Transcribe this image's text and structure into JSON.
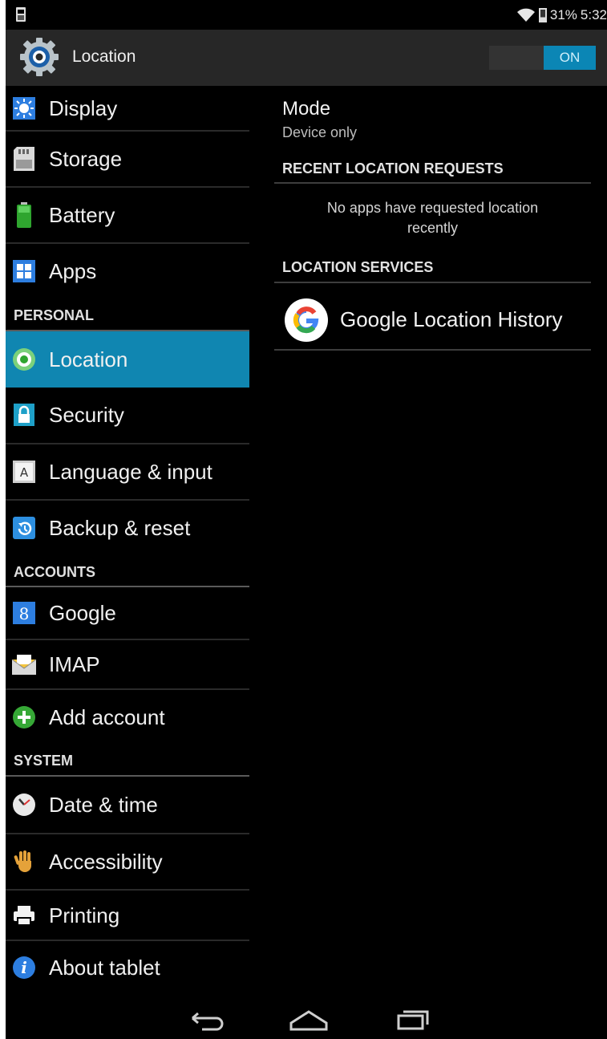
{
  "status_bar": {
    "battery": "31%",
    "time": "5:32"
  },
  "action_bar": {
    "title": "Location",
    "switch_label": "ON"
  },
  "left_list": [
    {
      "type": "item",
      "label": "Display",
      "icon": "display-icon"
    },
    {
      "type": "item",
      "label": "Storage",
      "icon": "storage-icon"
    },
    {
      "type": "item",
      "label": "Battery",
      "icon": "battery-icon"
    },
    {
      "type": "item",
      "label": "Apps",
      "icon": "apps-icon"
    },
    {
      "type": "header",
      "label": "PERSONAL"
    },
    {
      "type": "item",
      "label": "Location",
      "icon": "location-icon",
      "selected": true
    },
    {
      "type": "item",
      "label": "Security",
      "icon": "lock-icon"
    },
    {
      "type": "item",
      "label": "Language & input",
      "icon": "language-icon"
    },
    {
      "type": "item",
      "label": "Backup & reset",
      "icon": "backup-icon"
    },
    {
      "type": "header",
      "label": "ACCOUNTS"
    },
    {
      "type": "item",
      "label": "Google",
      "icon": "google-account-icon"
    },
    {
      "type": "item",
      "label": "IMAP",
      "icon": "envelope-icon"
    },
    {
      "type": "item",
      "label": "Add account",
      "icon": "add-icon"
    },
    {
      "type": "header",
      "label": "SYSTEM"
    },
    {
      "type": "item",
      "label": "Date & time",
      "icon": "clock-icon"
    },
    {
      "type": "item",
      "label": "Accessibility",
      "icon": "hand-icon"
    },
    {
      "type": "item",
      "label": "Printing",
      "icon": "printer-icon"
    },
    {
      "type": "item",
      "label": "About tablet",
      "icon": "info-icon"
    }
  ],
  "right_panel": {
    "mode_title": "Mode",
    "mode_value": "Device only",
    "recent_header": "RECENT LOCATION REQUESTS",
    "recent_empty": "No apps have requested location recently",
    "services_header": "LOCATION SERVICES",
    "service_label": "Google Location History"
  },
  "colors": {
    "accent": "#1086b1",
    "background": "#000000",
    "action_bar": "#272727"
  }
}
